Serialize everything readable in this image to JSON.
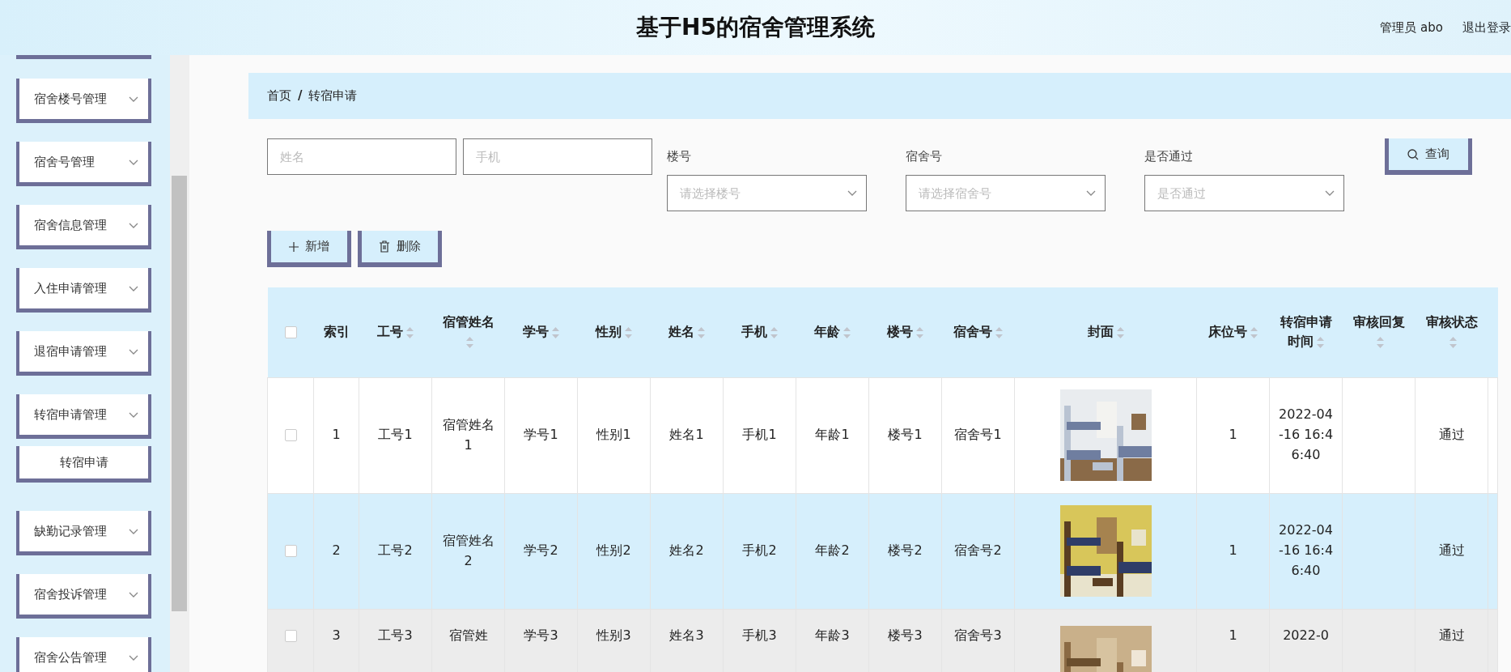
{
  "header": {
    "title": "基于H5的宿舍管理系统",
    "user": "管理员 abo",
    "logout": "退出登录"
  },
  "sidebar": {
    "items": [
      {
        "label": "宿舍楼号管理"
      },
      {
        "label": "宿舍号管理"
      },
      {
        "label": "宿舍信息管理"
      },
      {
        "label": "入住申请管理"
      },
      {
        "label": "退宿申请管理"
      },
      {
        "label": "转宿申请管理",
        "children": [
          {
            "label": "转宿申请"
          }
        ]
      },
      {
        "label": "缺勤记录管理"
      },
      {
        "label": "宿舍投诉管理"
      },
      {
        "label": "宿舍公告管理"
      }
    ]
  },
  "breadcrumb": {
    "items": [
      "首页",
      "转宿申请"
    ],
    "separator": "/"
  },
  "filters": [
    {
      "kind": "input",
      "placeholder": "姓名"
    },
    {
      "kind": "input",
      "placeholder": "手机"
    },
    {
      "kind": "select",
      "label": "楼号",
      "placeholder": "请选择楼号"
    },
    {
      "kind": "select",
      "label": "宿舍号",
      "placeholder": "请选择宿舍号"
    },
    {
      "kind": "select",
      "label": "是否通过",
      "placeholder": "是否通过"
    }
  ],
  "search_button": "查询",
  "actions": [
    {
      "kind": "add",
      "label": "新增"
    },
    {
      "kind": "delete",
      "label": "删除"
    }
  ],
  "table": {
    "select_all": {
      "checked": false
    },
    "columns": [
      {
        "label": "索引",
        "sortable": false
      },
      {
        "label": "工号",
        "sortable": true
      },
      {
        "label": "宿管姓名",
        "sortable": true
      },
      {
        "label": "学号",
        "sortable": true
      },
      {
        "label": "性别",
        "sortable": true
      },
      {
        "label": "姓名",
        "sortable": true
      },
      {
        "label": "手机",
        "sortable": true
      },
      {
        "label": "年龄",
        "sortable": true
      },
      {
        "label": "楼号",
        "sortable": true
      },
      {
        "label": "宿舍号",
        "sortable": true
      },
      {
        "label": "封面",
        "sortable": true
      },
      {
        "label": "床位号",
        "sortable": true
      },
      {
        "label": "转宿申请时间",
        "sortable": true
      },
      {
        "label": "审核回复",
        "sortable": true
      },
      {
        "label": "审核状态",
        "sortable": true
      }
    ],
    "rows": [
      {
        "checked": false,
        "cells": [
          "1",
          "工号1",
          "宿管姓名1",
          "学号1",
          "性别1",
          "姓名1",
          "手机1",
          "年龄1",
          "楼号1",
          "宿舍号1",
          {
            "kind": "picture"
          },
          "1",
          "2022-04-16 16:46:40",
          null,
          "通过"
        ]
      },
      {
        "checked": false,
        "cells": [
          "2",
          "工号2",
          "宿管姓名2",
          "学号2",
          "性别2",
          "姓名2",
          "手机2",
          "年龄2",
          "楼号2",
          "宿舍号2",
          {
            "kind": "picture"
          },
          "1",
          "2022-04-16 16:46:40",
          null,
          "通过"
        ]
      },
      {
        "checked": false,
        "cells": [
          "3",
          "工号3",
          "宿管姓",
          "学号3",
          "性别3",
          "姓名3",
          "手机3",
          "年龄3",
          "楼号3",
          "宿舍号3",
          {
            "kind": "picture"
          },
          "1",
          "2022-0",
          null,
          "通过"
        ]
      }
    ]
  }
}
